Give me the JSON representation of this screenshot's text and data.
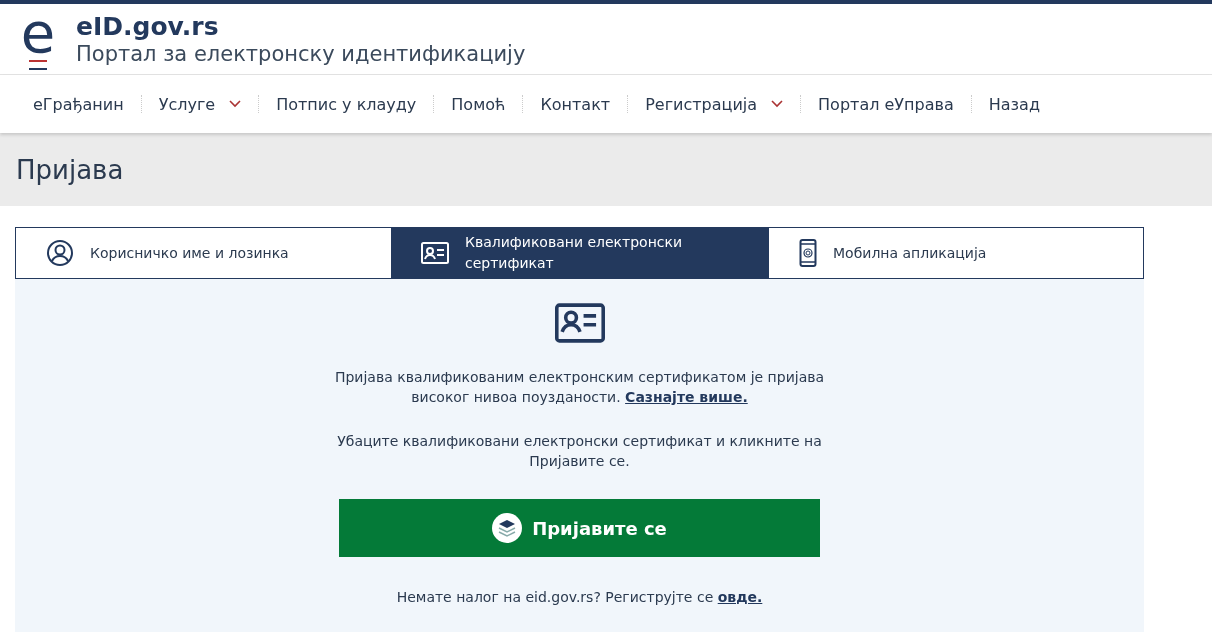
{
  "header": {
    "logo_letter": "e",
    "site": "eID.gov.rs",
    "subtitle": "Портал за електронску идентификацију"
  },
  "nav": [
    {
      "label": "еГрађанин",
      "kind": "link"
    },
    {
      "label": "Услуге",
      "kind": "dropdown"
    },
    {
      "label": "Потпис у клауду",
      "kind": "link"
    },
    {
      "label": "Помоћ",
      "kind": "link"
    },
    {
      "label": "Контакт",
      "kind": "link"
    },
    {
      "label": "Регистрација",
      "kind": "dropdown"
    },
    {
      "label": "Портал еУправа",
      "kind": "link"
    },
    {
      "label": "Назад",
      "kind": "link"
    }
  ],
  "page_title": "Пријава",
  "tabs": [
    {
      "label": "Корисничко име и лозинка",
      "kind": "user",
      "selected": false
    },
    {
      "label": "Квалификовани електронски сертификат",
      "kind": "card",
      "selected": true
    },
    {
      "label": "Мобилна апликација",
      "kind": "phone",
      "selected": false
    }
  ],
  "panel": {
    "info": {
      "text": "Пријава квалификованим електронским сертификатом је пријава високог нивоа поузданости.",
      "link": "Сазнајте више."
    },
    "instruction": "Убаците квалификовани електронски сертификат и кликните на Пријавите се.",
    "button": "Пријавите се",
    "register": {
      "text": "Немате налог на eid.gov.rs? Региструјте се",
      "link": "овде."
    }
  }
}
